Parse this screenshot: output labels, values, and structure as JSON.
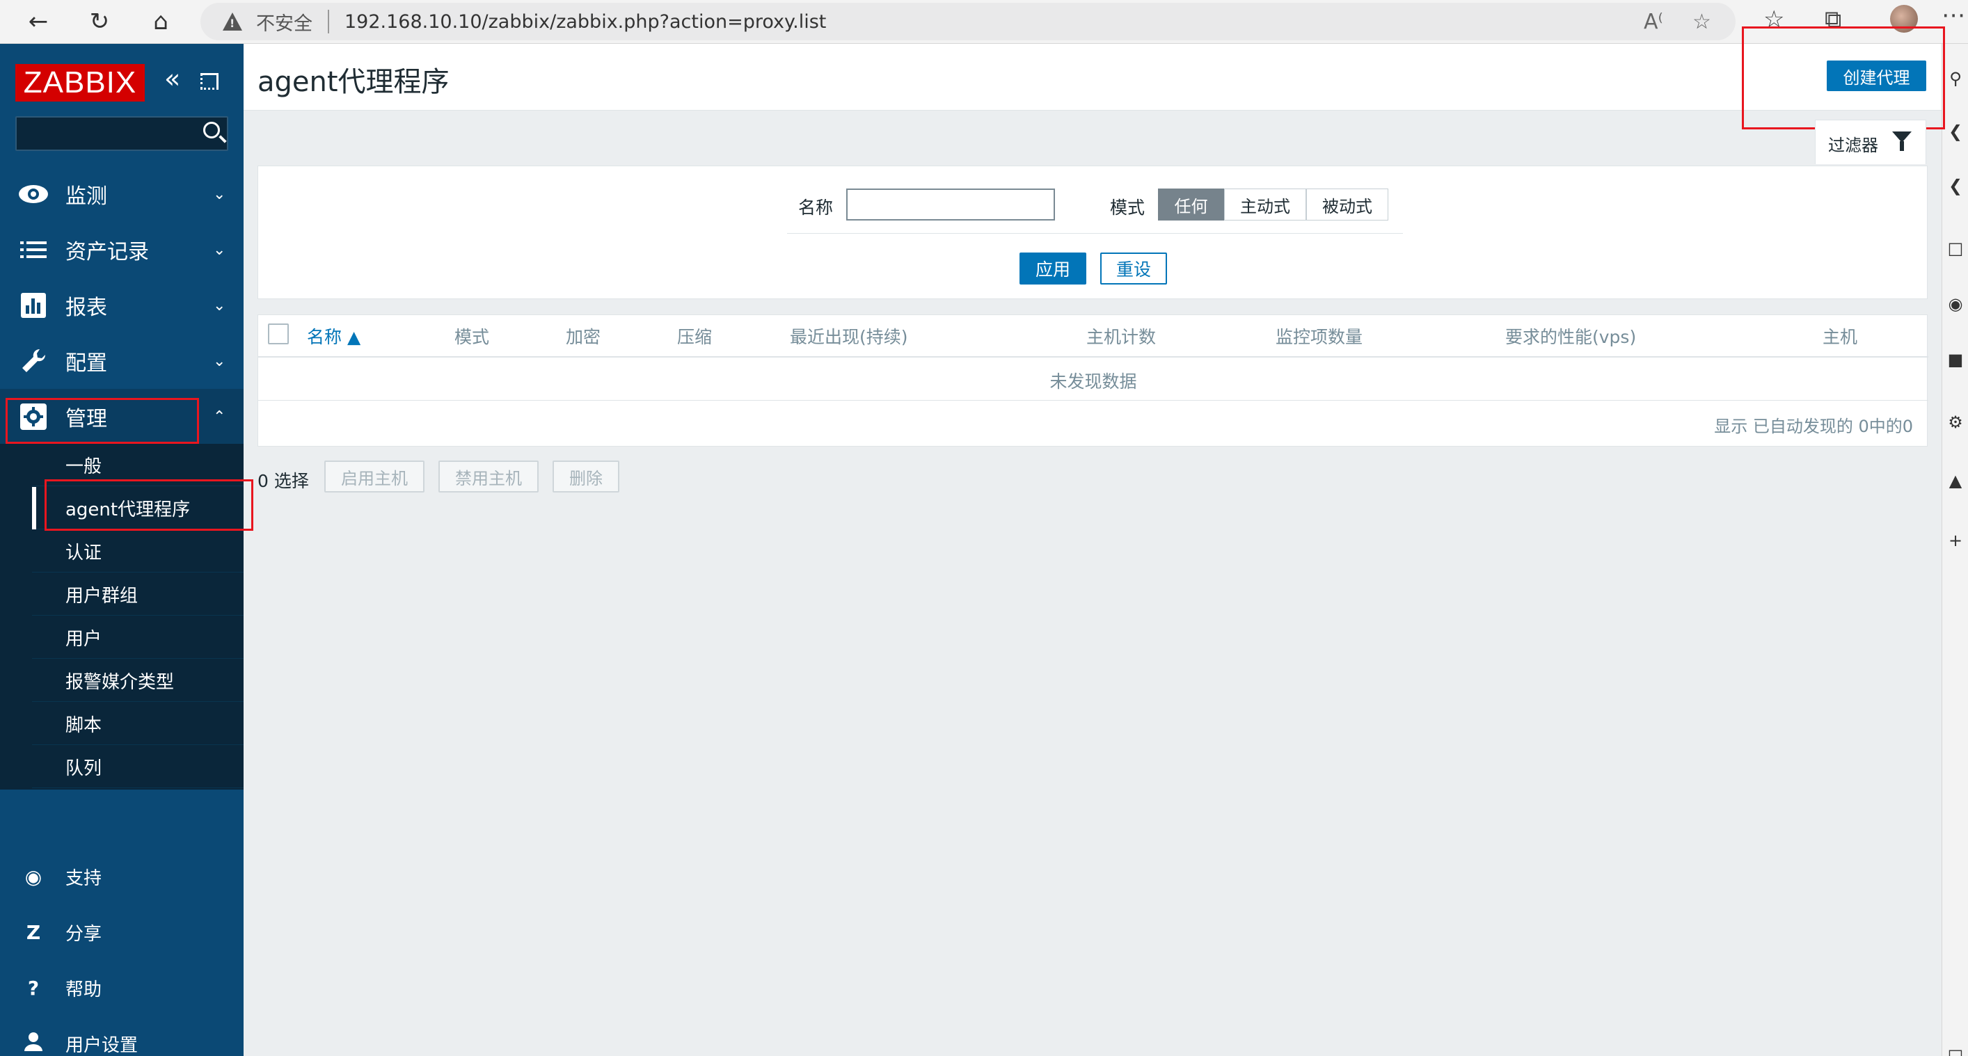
{
  "browser": {
    "security_label": "不安全",
    "url": "192.168.10.10/zabbix/zabbix.php?action=proxy.list"
  },
  "sidebar": {
    "logo": "ZABBIX",
    "menu": [
      {
        "label": "监测"
      },
      {
        "label": "资产记录"
      },
      {
        "label": "报表"
      },
      {
        "label": "配置"
      },
      {
        "label": "管理"
      }
    ],
    "submenu": [
      {
        "label": "一般"
      },
      {
        "label": "agent代理程序"
      },
      {
        "label": "认证"
      },
      {
        "label": "用户群组"
      },
      {
        "label": "用户"
      },
      {
        "label": "报警媒介类型"
      },
      {
        "label": "脚本"
      },
      {
        "label": "队列"
      }
    ],
    "bottom": [
      {
        "icon": "?",
        "label": "支持"
      },
      {
        "icon": "Z",
        "label": "分享"
      },
      {
        "icon": "?",
        "label": "帮助"
      },
      {
        "icon": "",
        "label": "用户设置"
      }
    ]
  },
  "header": {
    "title": "agent代理程序",
    "create_button": "创建代理"
  },
  "filter": {
    "tab_label": "过滤器",
    "name_label": "名称",
    "name_value": "",
    "mode_label": "模式",
    "modes": [
      "任何",
      "主动式",
      "被动式"
    ],
    "selected_mode": "任何",
    "apply": "应用",
    "reset": "重设"
  },
  "table": {
    "columns": [
      "名称 ▲",
      "模式",
      "加密",
      "压缩",
      "最近出现(持续)",
      "主机计数",
      "监控项数量",
      "要求的性能(vps)",
      "主机"
    ],
    "empty_text": "未发现数据",
    "paging": "显示 已自动发现的 0中的0"
  },
  "actions": {
    "selected": "0 选择",
    "enable_hosts": "启用主机",
    "disable_hosts": "禁用主机",
    "delete": "删除"
  },
  "colors": {
    "sidebar": "#0b4975",
    "primary": "#0275b8",
    "highlight": "#e8161f",
    "logo": "#d40000"
  }
}
